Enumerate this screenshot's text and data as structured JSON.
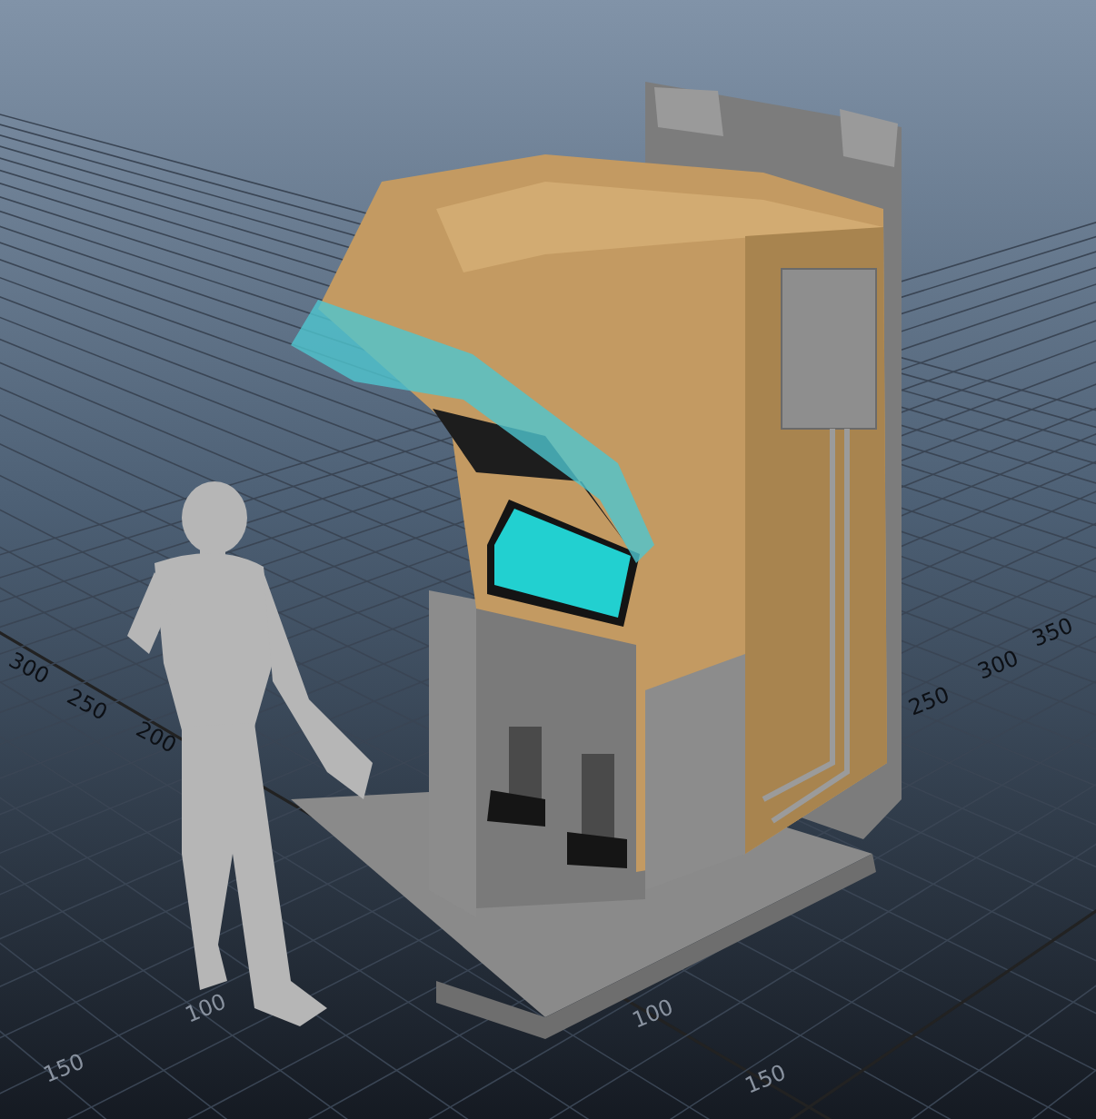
{
  "viewport": {
    "grid_labels": [
      {
        "text": "300",
        "kind": "left"
      },
      {
        "text": "250",
        "kind": "left"
      },
      {
        "text": "200",
        "kind": "left"
      },
      {
        "text": "350",
        "kind": "right"
      },
      {
        "text": "300",
        "kind": "right"
      },
      {
        "text": "250",
        "kind": "right"
      },
      {
        "text": "100",
        "kind": "front"
      },
      {
        "text": "150",
        "kind": "front"
      },
      {
        "text": "100",
        "kind": "front"
      },
      {
        "text": "150",
        "kind": "front"
      }
    ]
  }
}
